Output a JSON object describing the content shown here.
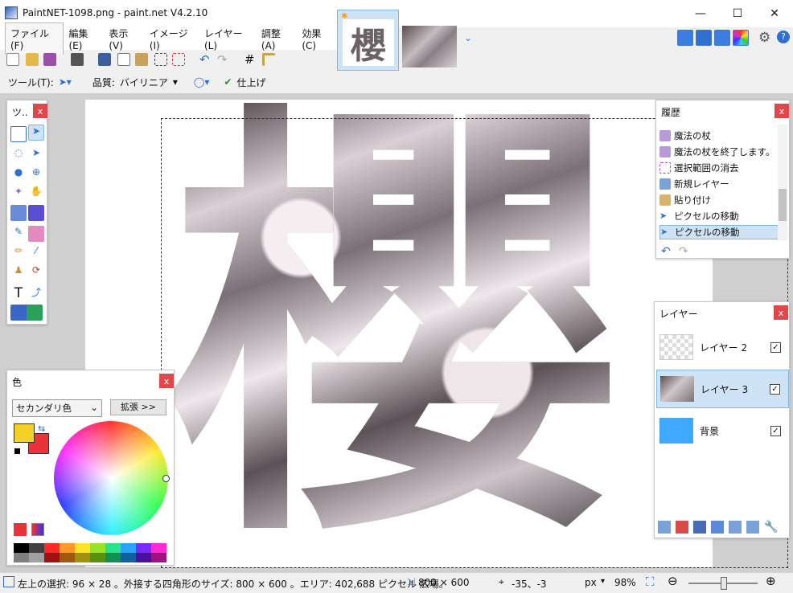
{
  "titlebar": {
    "title": "PaintNET-1098.png - paint.net V4.2.10",
    "minimize": "—",
    "maximize": "☐",
    "close": "✕"
  },
  "menu": {
    "items": [
      "ファイル(F)",
      "編集(E)",
      "表示(V)",
      "イメージ(I)",
      "レイヤー(L)",
      "調整(A)",
      "効果(C)"
    ]
  },
  "thumbnail": {
    "glyph": "櫻",
    "expand": "⌄"
  },
  "toolbar2": {
    "tool_label": "ツール(T):",
    "quality_label": "品質:",
    "quality_value": "バイリニア",
    "finish": "仕上げ"
  },
  "canvas": {
    "glyph": "櫻"
  },
  "tools_panel": {
    "title": "ツ..",
    "close": "x"
  },
  "colors_panel": {
    "title": "色",
    "close": "x",
    "mode": "セカンダリ色",
    "expand": "拡張 >>",
    "primary": "#f4d12a",
    "secondary": "#e8333a"
  },
  "history_panel": {
    "title": "履歴",
    "close": "x",
    "items": [
      "魔法の杖",
      "魔法の杖を終了します。",
      "選択範囲の消去",
      "新規レイヤー",
      "貼り付け",
      "ピクセルの移動",
      "ピクセルの移動"
    ]
  },
  "layers_panel": {
    "title": "レイヤー",
    "close": "x",
    "layers": [
      {
        "name": "レイヤー 2",
        "checked": "✓"
      },
      {
        "name": "レイヤー 3",
        "checked": "✓"
      },
      {
        "name": "背景",
        "checked": "✓"
      }
    ]
  },
  "status": {
    "selection": "左上の選択: 96 × 28 。外接する四角形のサイズ: 800 × 600 。エリア: 402,688 ピクセル 広場。",
    "image_size": "800 × 600",
    "cursor": "-35、-3",
    "unit": "px",
    "zoom": "98%"
  },
  "palette": [
    "#000000",
    "#404040",
    "#7f7f7f",
    "#c3c3c3",
    "#ffffff",
    "#880015",
    "#ed1c24",
    "#ff7f27",
    "#fff200",
    "#22b14c",
    "#00a2e8",
    "#3f48cc",
    "#a349a4",
    "#ff66cc",
    "#e5e5e5",
    "#99cc66",
    "#66cccc",
    "#6699ff",
    "#cc66ff",
    "#ff9999"
  ]
}
